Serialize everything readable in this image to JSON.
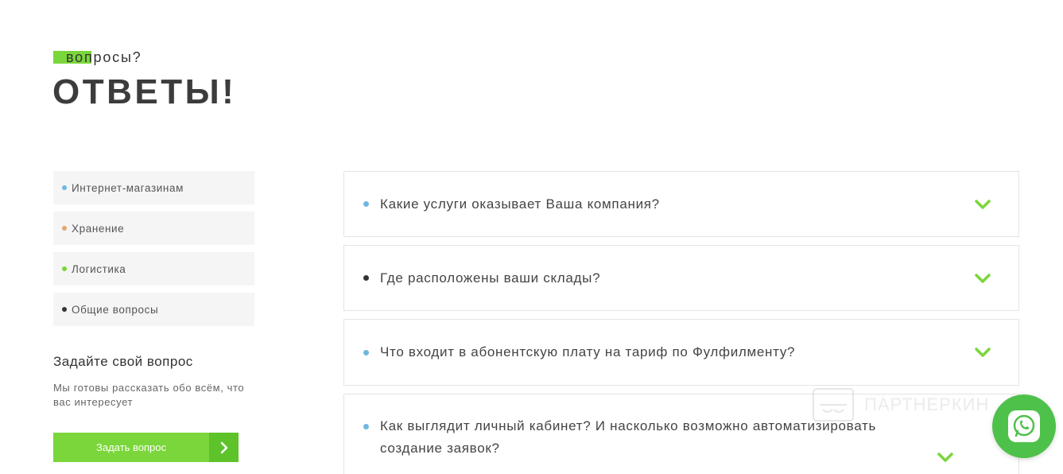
{
  "header": {
    "eyebrow": "вопросы?",
    "title": "ОТВЕТЫ!"
  },
  "categories": [
    {
      "label": "Интернет-магазинам",
      "color": "#6fb7e0"
    },
    {
      "label": "Хранение",
      "color": "#e0a86f"
    },
    {
      "label": "Логистика",
      "color": "#7ad63a"
    },
    {
      "label": "Общие вопросы",
      "color": "#333333"
    }
  ],
  "ask": {
    "title": "Задайте свой вопрос",
    "text": "Мы готовы рассказать обо всём, что вас интересует",
    "button_label": "Задать вопрос",
    "button_icon": "chevron-right-icon"
  },
  "faq": [
    {
      "question": "Какие услуги оказывает Ваша компания?",
      "dot_color": "#6fb7e0"
    },
    {
      "question": "Где расположены ваши склады?",
      "dot_color": "#333333"
    },
    {
      "question": "Что входит в абонентскую плату на тариф по Фулфилменту?",
      "dot_color": "#6fb7e0"
    },
    {
      "question": "Как выглядит личный кабинет? И насколько возможно автоматизировать создание заявок?",
      "dot_color": "#6fb7e0"
    }
  ],
  "watermark": {
    "text": "ПАРТНЕРКИН"
  },
  "colors": {
    "accent": "#7ad63a",
    "accent_dark": "#5ec22a",
    "whatsapp": "#4ec14b"
  }
}
